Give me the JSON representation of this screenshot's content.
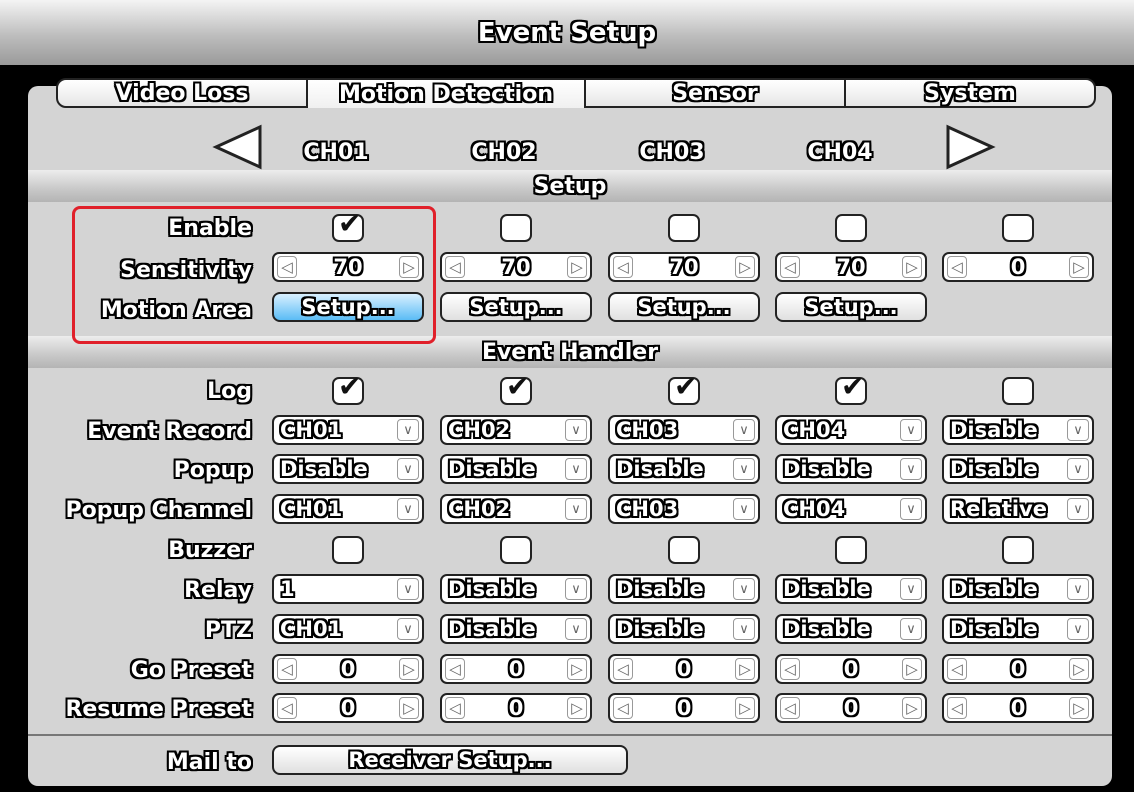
{
  "window": {
    "title": "Event Setup"
  },
  "tabs": [
    {
      "label": "Video Loss",
      "active": false
    },
    {
      "label": "Motion Detection",
      "active": true
    },
    {
      "label": "Sensor",
      "active": false
    },
    {
      "label": "System",
      "active": false
    }
  ],
  "channels": [
    "CH01",
    "CH02",
    "CH03",
    "CH04"
  ],
  "icons": {
    "prev": "left-triangle-icon",
    "next": "right-triangle-icon",
    "dropdown": "chevron-down-icon"
  },
  "setup_section": {
    "title": "Setup",
    "labels": {
      "enable": "Enable",
      "sensitivity": "Sensitivity",
      "motion_area": "Motion Area"
    },
    "enable": [
      true,
      false,
      false,
      false,
      false
    ],
    "sensitivity": [
      "70",
      "70",
      "70",
      "70",
      "0"
    ],
    "motion_area_buttons": [
      "Setup...",
      "Setup...",
      "Setup...",
      "Setup..."
    ]
  },
  "event_handler": {
    "title": "Event Handler",
    "labels": {
      "log": "Log",
      "event_record": "Event Record",
      "popup": "Popup",
      "popup_channel": "Popup Channel",
      "buzzer": "Buzzer",
      "relay": "Relay",
      "ptz": "PTZ",
      "go_preset": "Go Preset",
      "resume_preset": "Resume Preset"
    },
    "log": [
      true,
      true,
      true,
      true,
      false
    ],
    "event_record": [
      "CH01",
      "CH02",
      "CH03",
      "CH04",
      "Disable"
    ],
    "popup": [
      "Disable",
      "Disable",
      "Disable",
      "Disable",
      "Disable"
    ],
    "popup_channel": [
      "CH01",
      "CH02",
      "CH03",
      "CH04",
      "Relative"
    ],
    "buzzer": [
      false,
      false,
      false,
      false,
      false
    ],
    "relay": [
      "1",
      "Disable",
      "Disable",
      "Disable",
      "Disable"
    ],
    "ptz": [
      "CH01",
      "Disable",
      "Disable",
      "Disable",
      "Disable"
    ],
    "go_preset": [
      "0",
      "0",
      "0",
      "0",
      "0"
    ],
    "resume_preset": [
      "0",
      "0",
      "0",
      "0",
      "0"
    ]
  },
  "mail": {
    "label": "Mail to",
    "button": "Receiver Setup..."
  },
  "colors": {
    "highlight": "#e0202a",
    "focus_button": "#5bbcf5"
  }
}
